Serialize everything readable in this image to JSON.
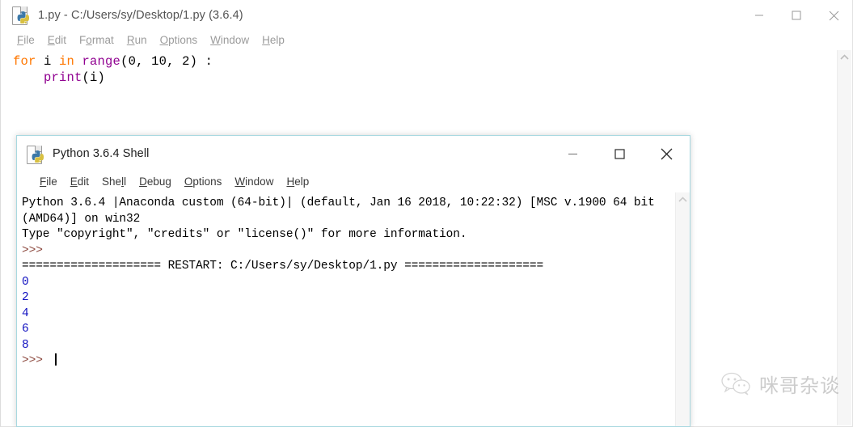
{
  "editor": {
    "title": "1.py - C:/Users/sy/Desktop/1.py (3.6.4)",
    "icon": "python-file-icon",
    "menus": [
      {
        "pre": "",
        "key": "F",
        "post": "ile"
      },
      {
        "pre": "",
        "key": "E",
        "post": "dit"
      },
      {
        "pre": "F",
        "key": "o",
        "post": "rmat"
      },
      {
        "pre": "",
        "key": "R",
        "post": "un"
      },
      {
        "pre": "",
        "key": "O",
        "post": "ptions"
      },
      {
        "pre": "",
        "key": "W",
        "post": "indow"
      },
      {
        "pre": "",
        "key": "H",
        "post": "elp"
      }
    ],
    "code": {
      "line1": {
        "kw_for": "for",
        "var_i": " i ",
        "kw_in": "in",
        "fn_range": " range",
        "args": "(0, 10, 2) :"
      },
      "line2": {
        "indent": "    ",
        "fn_print": "print",
        "args": "(i)"
      }
    },
    "controls": {
      "minimize": "minimize-button",
      "maximize": "maximize-button",
      "close": "close-button"
    }
  },
  "shell": {
    "title": "Python 3.6.4 Shell",
    "icon": "python-file-icon",
    "menus": [
      {
        "pre": "",
        "key": "F",
        "post": "ile"
      },
      {
        "pre": "",
        "key": "E",
        "post": "dit"
      },
      {
        "pre": "She",
        "key": "l",
        "post": "l"
      },
      {
        "pre": "",
        "key": "D",
        "post": "ebug"
      },
      {
        "pre": "",
        "key": "O",
        "post": "ptions"
      },
      {
        "pre": "",
        "key": "W",
        "post": "indow"
      },
      {
        "pre": "",
        "key": "H",
        "post": "elp"
      }
    ],
    "banner_line1": "Python 3.6.4 |Anaconda custom (64-bit)| (default, Jan 16 2018, 10:22:32) [MSC v.1900 64 bit (AMD64)] on win32",
    "banner_line2": "Type \"copyright\", \"credits\" or \"license()\" for more information.",
    "prompt1": ">>> ",
    "restart_line": "==================== RESTART: C:/Users/sy/Desktop/1.py ====================",
    "output": "0\n2\n4\n6\n8",
    "prompt2": ">>> ",
    "controls": {
      "minimize": "minimize-button",
      "maximize": "maximize-button",
      "close": "close-button"
    }
  },
  "watermark": {
    "text": "咪哥杂谈",
    "icon": "wechat-bubbles-icon"
  },
  "colors": {
    "keyword": "#ff7700",
    "builtin": "#900090",
    "stdout": "#1010c0",
    "prompt": "#8d4a40",
    "active_border": "#a8d8e0"
  }
}
